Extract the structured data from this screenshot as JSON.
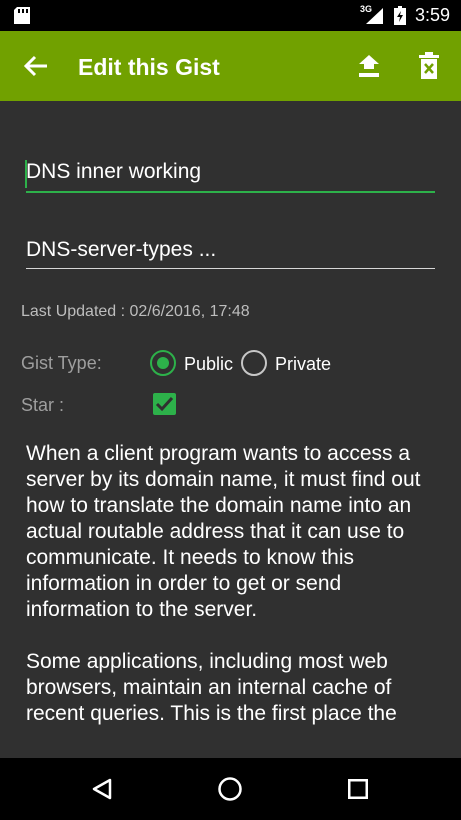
{
  "status_bar": {
    "network": "3G",
    "time": "3:59",
    "icons": [
      "sd-card-icon",
      "signal-icon",
      "battery-icon"
    ]
  },
  "app_bar": {
    "title": "Edit this Gist",
    "icons": [
      "back-arrow-icon",
      "upload-icon",
      "delete-icon"
    ],
    "color": "#71a100"
  },
  "form": {
    "title_value": "DNS inner working",
    "description_value": "DNS-server-types ...",
    "last_updated": "Last Updated : 02/6/2016, 17:48",
    "gist_type_label": "Gist Type:",
    "gist_type_options": [
      "Public",
      "Private"
    ],
    "gist_type_selected": "Public",
    "star_label": "Star :",
    "star_checked": true,
    "accent_color": "#2db14a"
  },
  "content": {
    "text": "When a client program wants to access a server by its domain name, it must find out how to translate the domain name into an actual routable address that it can use to communicate. It needs to know this information in order to get or send information to the server.\n\nSome applications, including most web browsers, maintain an internal cache of recent queries. This is the first place the"
  },
  "nav_bar": {
    "icons": [
      "nav-back-icon",
      "nav-home-icon",
      "nav-recents-icon"
    ]
  }
}
